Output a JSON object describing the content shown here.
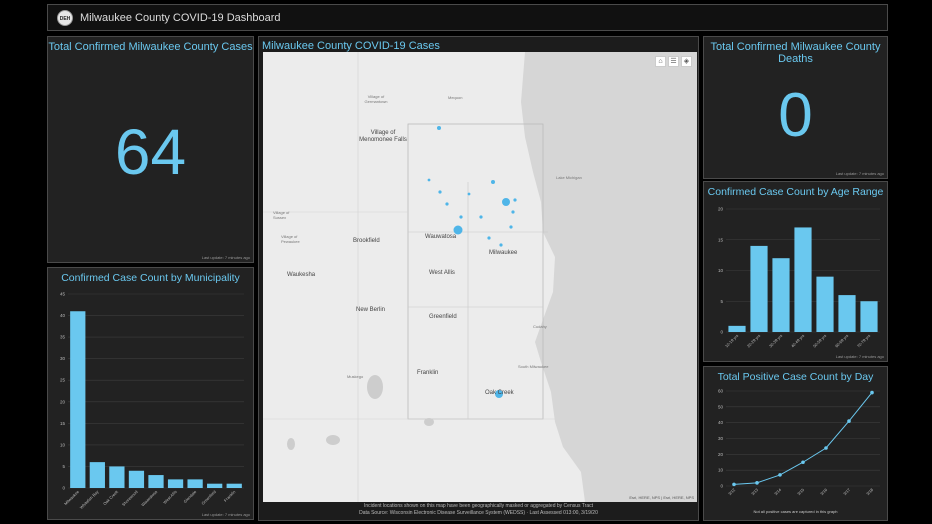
{
  "app": {
    "title": "Milwaukee County COVID-19 Dashboard",
    "logo_text": "DEH"
  },
  "colors": {
    "accent": "#6ac8ef",
    "panel_bg": "#222222",
    "background": "#000000"
  },
  "cases_panel": {
    "title": "Total Confirmed Milwaukee County Cases",
    "value": "64",
    "last_update": "Last update: 7 minutes ago"
  },
  "deaths_panel": {
    "title": "Total Confirmed Milwaukee County Deaths",
    "value": "0",
    "last_update": "Last update: 7 minutes ago"
  },
  "map_panel": {
    "title": "Milwaukee County COVID-19 Cases",
    "tools": [
      "home-icon",
      "list-icon",
      "layers-icon"
    ],
    "places": [
      "Village of Menomonee Falls",
      "Brookfield",
      "Waukesha",
      "New Berlin",
      "Wauwatosa",
      "West Allis",
      "Milwaukee",
      "Greenfield",
      "Franklin",
      "Oak Creek",
      "Muskego",
      "Cudahy",
      "South Milwaukee",
      "Village of Germantown",
      "Village of Sussex",
      "Village of Pewaukee",
      "Lake Michigan",
      "Mequon"
    ],
    "attribution": "Esri, HERE, NPS | Esri, HERE, NPS",
    "footnote": "Incident locations shown on this map have been geographically masked or aggregated by Census Tract",
    "source": "Data Source: Wisconsin Electronic Disease Surveillance System (WEDSS) · Last Assessed 013:00, 3/19/20"
  },
  "municipality_panel": {
    "title": "Confirmed Case Count by Municipality",
    "last_update": "Last update: 7 minutes ago",
    "chart_data": {
      "type": "bar",
      "categories": [
        "Milwaukee",
        "Whitefish Bay",
        "Oak Creek",
        "Shorewood",
        "Wauwatosa",
        "West Allis",
        "Glendale",
        "Greenfield",
        "Franklin"
      ],
      "values": [
        41,
        6,
        5,
        4,
        3,
        2,
        2,
        1,
        1
      ],
      "ylim": [
        0,
        45
      ],
      "yticks": [
        "0",
        "5",
        "10",
        "15",
        "20",
        "25",
        "30",
        "35",
        "40",
        "45"
      ],
      "grid": true
    }
  },
  "age_panel": {
    "title": "Confirmed Case Count by Age Range",
    "last_update": "Last update: 7 minutes ago",
    "chart_data": {
      "type": "bar",
      "categories": [
        "10-19 yrs",
        "20-29 yrs",
        "30-39 yrs",
        "40-49 yrs",
        "50-59 yrs",
        "60-69 yrs",
        "70-79 yrs"
      ],
      "values": [
        1,
        14,
        12,
        17,
        9,
        6,
        5
      ],
      "ylim": [
        0,
        20
      ],
      "yticks": [
        "0",
        "5",
        "10",
        "15",
        "20"
      ],
      "grid": true
    }
  },
  "daily_panel": {
    "title": "Total Positive Case Count by Day",
    "note": "Not all positive cases are captured in this graph",
    "chart_data": {
      "type": "line",
      "categories": [
        "3/12",
        "3/13",
        "3/14",
        "3/15",
        "3/16",
        "3/17",
        "3/18"
      ],
      "values": [
        1,
        2,
        7,
        15,
        24,
        41,
        59
      ],
      "ylim": [
        0,
        60
      ],
      "yticks": [
        "0",
        "10",
        "20",
        "30",
        "40",
        "50",
        "60"
      ],
      "grid": true
    }
  }
}
